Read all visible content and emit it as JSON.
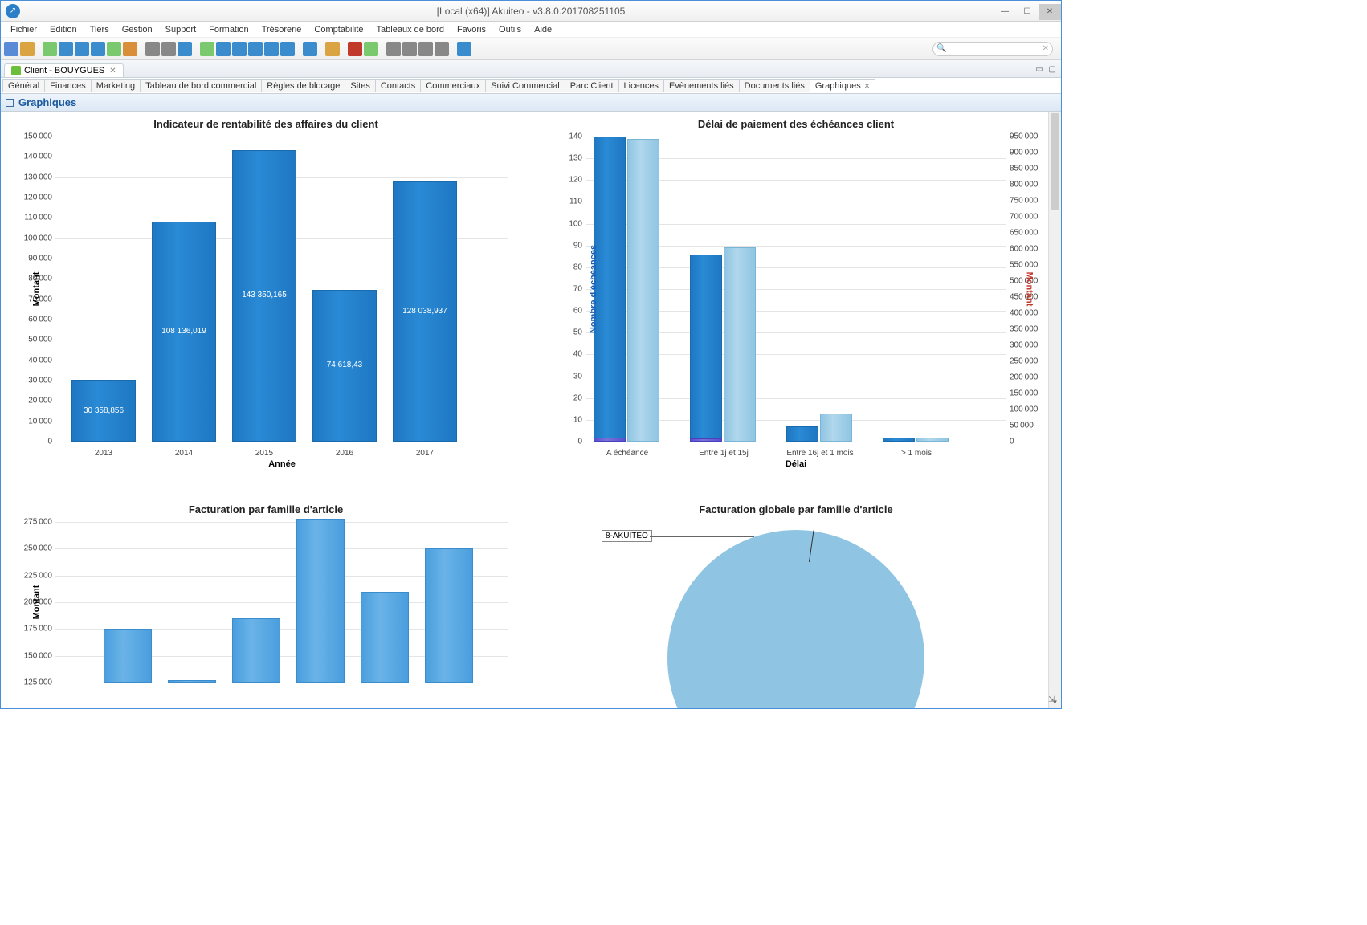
{
  "window": {
    "title": "[Local (x64)] Akuiteo - v3.8.0.201708251105"
  },
  "menubar": [
    "Fichier",
    "Edition",
    "Tiers",
    "Gestion",
    "Support",
    "Formation",
    "Trésorerie",
    "Comptabilité",
    "Tableaux de bord",
    "Favoris",
    "Outils",
    "Aide"
  ],
  "doctab": {
    "label": "Client - BOUYGUES"
  },
  "subtabs": [
    "Général",
    "Finances",
    "Marketing",
    "Tableau de bord commercial",
    "Règles de blocage",
    "Sites",
    "Contacts",
    "Commerciaux",
    "Suivi Commercial",
    "Parc Client",
    "Licences",
    "Evènements liés",
    "Documents liés",
    "Graphiques"
  ],
  "active_subtab": "Graphiques",
  "section_title": "Graphiques",
  "toolbar_icons": [
    {
      "n": "save-icon",
      "c": "#5a8bd6"
    },
    {
      "n": "open-icon",
      "c": "#d9a441"
    },
    {
      "n": "sep"
    },
    {
      "n": "script-icon",
      "c": "#7bc96f"
    },
    {
      "n": "edit-icon",
      "c": "#3a8ccc"
    },
    {
      "n": "paste-icon",
      "c": "#3a8ccc"
    },
    {
      "n": "config-icon",
      "c": "#3a8ccc"
    },
    {
      "n": "highlight-icon",
      "c": "#7bc96f"
    },
    {
      "n": "action-icon",
      "c": "#d98f3a"
    },
    {
      "n": "sep"
    },
    {
      "n": "print-preview-icon",
      "c": "#888"
    },
    {
      "n": "print-icon",
      "c": "#888"
    },
    {
      "n": "preview-icon",
      "c": "#3a8ccc"
    },
    {
      "n": "sep"
    },
    {
      "n": "list-icon",
      "c": "#7bc96f"
    },
    {
      "n": "refresh-icon",
      "c": "#3a8ccc"
    },
    {
      "n": "filter-icon",
      "c": "#3a8ccc"
    },
    {
      "n": "export-icon",
      "c": "#3a8ccc"
    },
    {
      "n": "table-icon",
      "c": "#3a8ccc"
    },
    {
      "n": "settings-icon",
      "c": "#3a8ccc"
    },
    {
      "n": "sep"
    },
    {
      "n": "grid-icon",
      "c": "#3a8ccc"
    },
    {
      "n": "sep"
    },
    {
      "n": "folder-icon",
      "c": "#d9a441"
    },
    {
      "n": "sep"
    },
    {
      "n": "chart-pie-icon",
      "c": "#c0392b"
    },
    {
      "n": "sheet-icon",
      "c": "#7bc96f"
    },
    {
      "n": "sep"
    },
    {
      "n": "nav-first-icon",
      "c": "#888"
    },
    {
      "n": "nav-prev-icon",
      "c": "#888"
    },
    {
      "n": "nav-next-icon",
      "c": "#888"
    },
    {
      "n": "nav-last-icon",
      "c": "#888"
    },
    {
      "n": "sep"
    },
    {
      "n": "close-all-icon",
      "c": "#3a8ccc"
    }
  ],
  "search": {
    "placeholder": ""
  },
  "chart_data": [
    {
      "type": "bar",
      "title": "Indicateur de rentabilité des affaires du client",
      "xlabel": "Année",
      "ylabel": "Montant",
      "ylim": [
        0,
        150000
      ],
      "ytick_step": 10000,
      "categories": [
        "2013",
        "2014",
        "2015",
        "2016",
        "2017"
      ],
      "values": [
        30358.856,
        108136.019,
        143350.165,
        74618.43,
        128038.937
      ],
      "value_labels": [
        "30 358,856",
        "108 136,019",
        "143 350,165",
        "74 618,43",
        "128 038,937"
      ]
    },
    {
      "type": "bar",
      "title": "Délai de paiement des échéances client",
      "xlabel": "Délai",
      "ylabel_left": "Nombre d'échéances",
      "ylabel_right": "Montant",
      "ylim_left": [
        0,
        140
      ],
      "ylim_right": [
        0,
        950000
      ],
      "ytick_step_left": 10,
      "ytick_step_right": 50000,
      "categories": [
        "A échéance",
        "Entre 1j et 15j",
        "Entre 16j et 1 mois",
        "> 1 mois"
      ],
      "series": [
        {
          "name": "count_dark",
          "values": [
            140,
            86,
            7,
            2
          ],
          "color": "dark"
        },
        {
          "name": "count_light",
          "values": [
            139,
            89,
            13,
            2
          ],
          "color": "light"
        },
        {
          "name": "amount_purple",
          "values": [
            12000,
            10000,
            0,
            0
          ],
          "color": "purple"
        }
      ]
    },
    {
      "type": "bar",
      "title": "Facturation par famille d'article",
      "ylabel": "Montant",
      "ylim": [
        125000,
        275000
      ],
      "ytick_step": 25000,
      "categories_count": 7,
      "values": [
        175000,
        127000,
        185000,
        278000,
        210000,
        250000,
        null
      ]
    },
    {
      "type": "pie",
      "title": "Facturation globale par famille d'article",
      "slices": [
        {
          "label": "8-AKUITEO",
          "value": 100
        }
      ]
    }
  ],
  "pie_annotation": "8-AKUITEO"
}
